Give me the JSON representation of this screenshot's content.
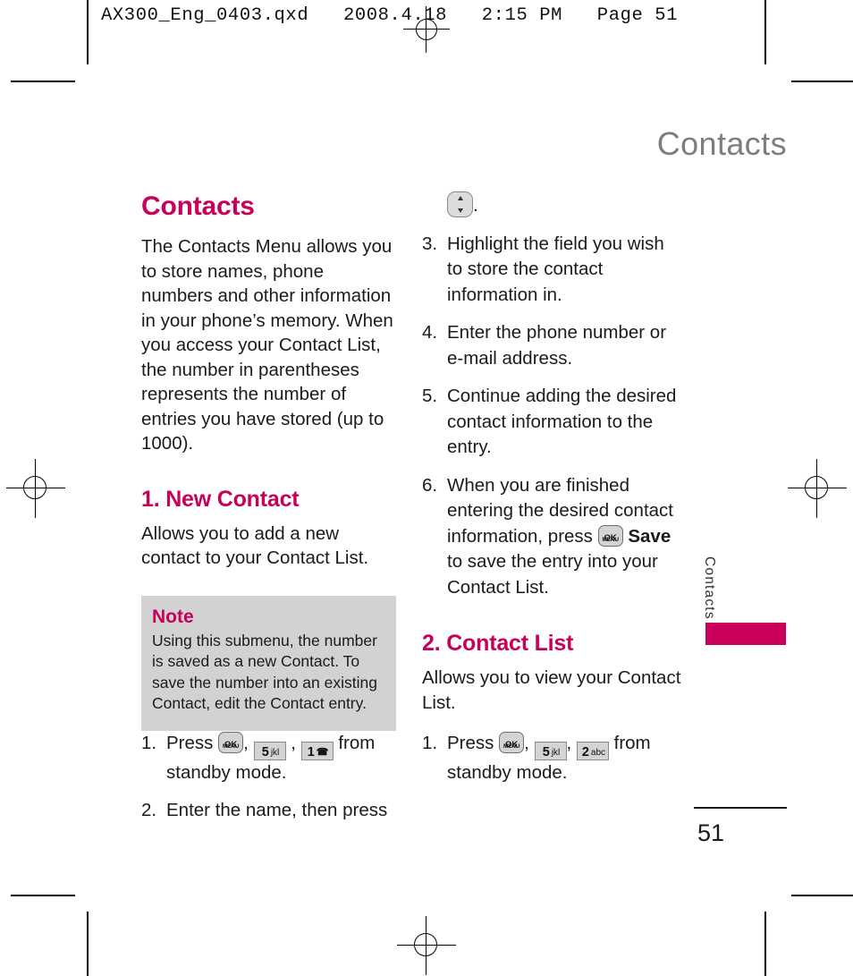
{
  "print_header": "AX300_Eng_0403.qxd   2008.4.18   2:15 PM   Page 51",
  "running_head": "Contacts",
  "colors": {
    "brand": "#c8005a",
    "note_background": "#d2d2d2",
    "running_head": "#7d7d7d",
    "body_text": "#1b1b1b"
  },
  "left_column": {
    "chapter_title": "Contacts",
    "intro": "The Contacts Menu allows you to store names, phone numbers and other information in your phone’s memory. When you access your Contact List, the number in parentheses represents the number of entries you have stored (up to 1000).",
    "section_1": {
      "heading": "1. New Contact",
      "description": "Allows you to add a new contact to your Contact List.",
      "note": {
        "title": "Note",
        "text": "Using this submenu, the number is saved as a new Contact. To save the number into an existing Contact, edit the Contact entry."
      },
      "steps": [
        {
          "num": "1.",
          "pre": "Press",
          "keys": [
            "menu-ok-key",
            "5-jkl-key",
            "1-voicemail-key"
          ],
          "post": "from standby mode."
        },
        {
          "num": "2.",
          "pre": "Enter the name, then press",
          "keys": [],
          "post": ""
        }
      ]
    }
  },
  "right_column": {
    "continued_key_line": ".",
    "steps": [
      {
        "num": "3.",
        "text": "Highlight the field you wish to store the contact information in."
      },
      {
        "num": "4.",
        "text": "Enter the phone number or e-mail address."
      },
      {
        "num": "5.",
        "text": "Continue adding the desired contact information to the entry."
      },
      {
        "num": "6.",
        "text_before": "When you are finished entering the desired contact information, press",
        "bold_word": "Save",
        "text_after": "to save the entry into your Contact List."
      }
    ],
    "section_2": {
      "heading": "2. Contact List",
      "description": "Allows you to view your Contact List.",
      "step": {
        "num": "1.",
        "pre": "Press",
        "post": "from standby mode."
      }
    }
  },
  "keys": {
    "menu_ok": {
      "line1": "MENU",
      "line2": "OK"
    },
    "five_jkl": {
      "digit": "5",
      "letters": "jkl"
    },
    "one_voicemail": {
      "digit": "1",
      "letters": "☎"
    },
    "two_abc": {
      "digit": "2",
      "letters": "abc"
    }
  },
  "side_tab": {
    "label": "Contacts"
  },
  "folio": {
    "page_number": "51"
  }
}
